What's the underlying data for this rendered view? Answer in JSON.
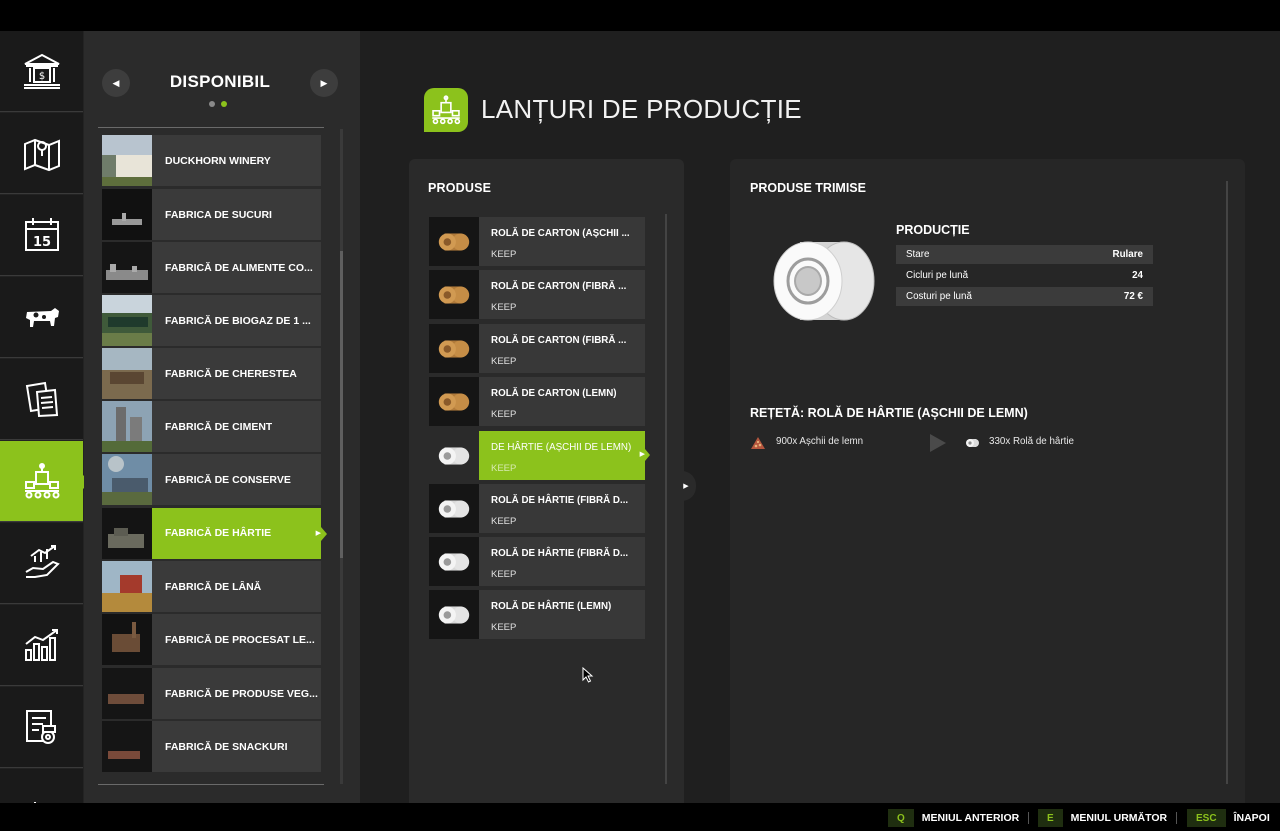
{
  "list": {
    "title": "DISPONIBIL",
    "prev_glyph": "◀",
    "next_glyph": "▶",
    "items": [
      "DUCKHORN WINERY",
      "FABRICA DE SUCURI",
      "FABRICĂ DE ALIMENTE CO...",
      "FABRICĂ DE BIOGAZ DE 1 ...",
      "FABRICĂ DE CHERESTEA",
      "FABRICĂ DE CIMENT",
      "FABRICĂ DE CONSERVE",
      "FABRICĂ DE HÂRTIE",
      "FABRICĂ DE LÂNĂ",
      "FABRICĂ DE PROCESAT LE...",
      "FABRICĂ DE PRODUSE VEG...",
      "FABRICĂ DE SNACKURI"
    ],
    "selected_index": 7
  },
  "header": {
    "title": "LANȚURI DE PRODUCȚIE"
  },
  "products": {
    "title": "PRODUSE",
    "items": [
      {
        "name": "ROLĂ DE CARTON (AȘCHII ...",
        "mode": "KEEP",
        "kind": "cardboard"
      },
      {
        "name": "ROLĂ DE CARTON (FIBRĂ ...",
        "mode": "KEEP",
        "kind": "cardboard"
      },
      {
        "name": "ROLĂ DE CARTON (FIBRĂ ...",
        "mode": "KEEP",
        "kind": "cardboard"
      },
      {
        "name": "ROLĂ DE CARTON (LEMN)",
        "mode": "KEEP",
        "kind": "cardboard"
      },
      {
        "name": "DE HÂRTIE (AȘCHII DE LEMN)",
        "mode": "KEEP",
        "kind": "paper"
      },
      {
        "name": "ROLĂ DE HÂRTIE (FIBRĂ D...",
        "mode": "KEEP",
        "kind": "paper"
      },
      {
        "name": "ROLĂ DE HÂRTIE (FIBRĂ D...",
        "mode": "KEEP",
        "kind": "paper"
      },
      {
        "name": "ROLĂ DE HÂRTIE (LEMN)",
        "mode": "KEEP",
        "kind": "paper"
      }
    ],
    "selected_index": 4
  },
  "details": {
    "title": "PRODUSE TRIMISE",
    "production_title": "PRODUCȚIE",
    "rows": [
      {
        "label": "Stare",
        "value": "Rulare"
      },
      {
        "label": "Cicluri pe lună",
        "value": "24"
      },
      {
        "label": "Costuri pe lună",
        "value": "72 €"
      }
    ],
    "recipe_title": "REȚETĂ: ROLĂ DE HÂRTIE (AȘCHII DE LEMN)",
    "recipe_input": "900x Așchii de lemn",
    "recipe_output": "330x Rolă de hârtie"
  },
  "footer": {
    "hints": [
      {
        "key": "Q",
        "label": "MENIUL ANTERIOR"
      },
      {
        "key": "E",
        "label": "MENIUL URMĂTOR"
      },
      {
        "key": "ESC",
        "label": "ÎNAPOI"
      }
    ]
  },
  "colors": {
    "accent": "#8cc21c",
    "panel": "#2a2a2a",
    "background": "#1f1f1f"
  },
  "rail_icons": [
    "finances-icon",
    "map-icon",
    "calendar-icon",
    "animals-icon",
    "contracts-icon",
    "production-icon",
    "prices-icon",
    "statistics-icon",
    "vehicles-icon",
    "more-icon"
  ],
  "calendar_day": "15"
}
